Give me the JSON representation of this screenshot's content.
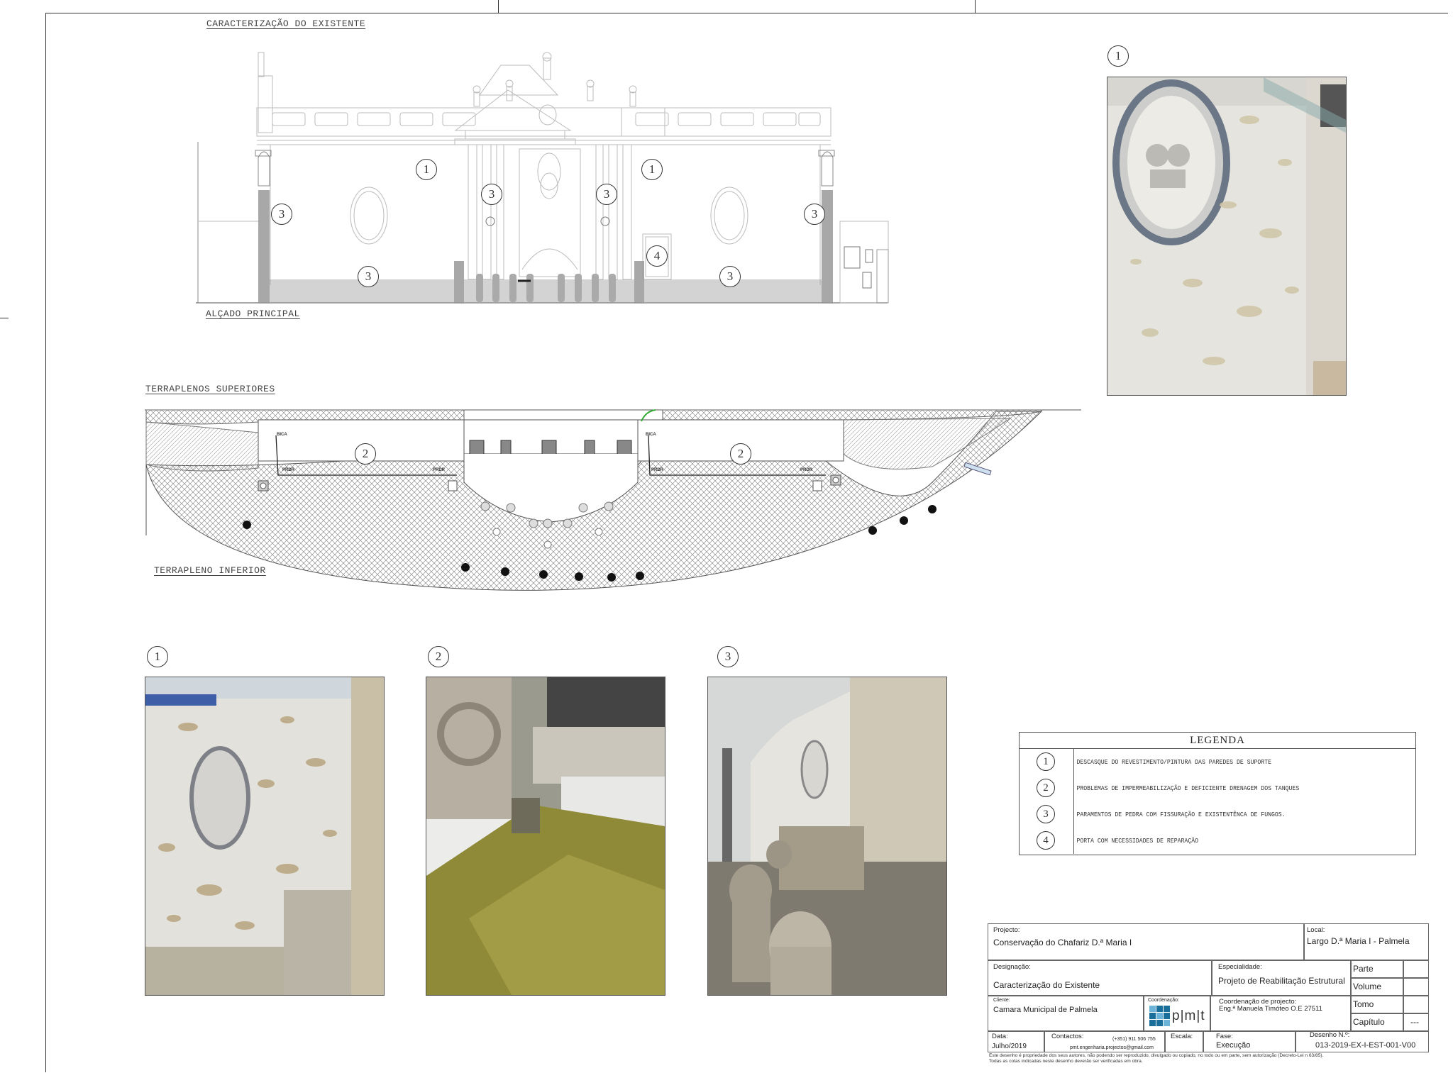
{
  "headings": {
    "caracterizacao": "CARACTERIZAÇÃO DO EXISTENTE",
    "alcado": "ALÇADO PRINCIPAL",
    "terraplenos_superiores": "TERRAPLENOS SUPERIORES",
    "terrapleno_inferior": "TERRAPLENO INFERIOR"
  },
  "elevation_markers": [
    "1",
    "1",
    "3",
    "3",
    "3",
    "3",
    "3",
    "3",
    "4"
  ],
  "plan_markers": [
    "2",
    "2"
  ],
  "plan_labels": {
    "bica": "BICA",
    "prdr": "PRDR"
  },
  "photo_markers": {
    "top_right": "1",
    "bottom_1": "1",
    "bottom_2": "2",
    "bottom_3": "3"
  },
  "legend": {
    "title": "LEGENDA",
    "items": [
      {
        "num": "1",
        "text": "DESCASQUE DO REVESTIMENTO/PINTURA DAS PAREDES DE SUPORTE"
      },
      {
        "num": "2",
        "text": "PROBLEMAS DE IMPERMEABILIZAÇÃO E DEFICIENTE DRENAGEM DOS TANQUES"
      },
      {
        "num": "3",
        "text": "PARAMENTOS DE PEDRA COM FISSURAÇÃO E EXISTENTÊNCA DE FUNGOS."
      },
      {
        "num": "4",
        "text": "PORTA COM NECESSIDADES DE REPARAÇÃO"
      }
    ]
  },
  "title_block": {
    "projecto_label": "Projecto:",
    "projecto": "Conservação do Chafariz D.ª Maria I",
    "local_label": "Local:",
    "local": "Largo D.ª Maria I - Palmela",
    "designacao_label": "Designação:",
    "designacao": "Caracterização do Existente",
    "especialidade_label": "Especialidade:",
    "especialidade": "Projeto de Reabilitação Estrutural",
    "parte": "Parte",
    "volume": "Volume",
    "tomo": "Tomo",
    "capitulo": "Capítulo",
    "capitulo_val": "---",
    "cliente_label": "Cliente:",
    "cliente": "Camara Municipal de Palmela",
    "coordenacao_label": "Coordenação:",
    "logo_text": "p|m|t",
    "coord_projecto_label": "Coordenação de projecto:",
    "coord_projecto": "Eng.ª Manuela Timóteo  O.E 27511",
    "data_label": "Data:",
    "data": "Julho/2019",
    "contactos_label": "Contactos:",
    "telefone": "(+351) 911 506 755",
    "email": "pmt.engenharia.projectos@gmail.com",
    "escala_label": "Escala:",
    "fase_label": "Fase:",
    "fase": "Execução",
    "desenho_label": "Desenho N.º:",
    "desenho": "013-2019-EX-I-EST-001-V00"
  },
  "disclaimer": [
    "Este desenho é propriedade dos seus autores, não podendo ser reproduzido, divulgado ou copiado, no todo ou em parte, sem autorização (Decreto-Lei n 63/85).",
    "Todas as cotas indicadas neste desenho deverão ser verificadas em obra."
  ]
}
